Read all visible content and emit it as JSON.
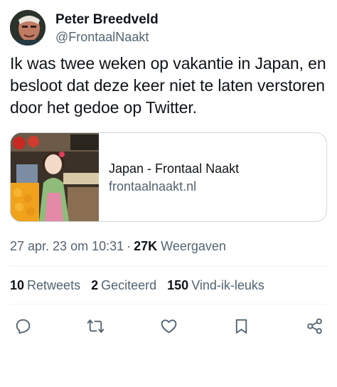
{
  "author": {
    "display_name": "Peter Breedveld",
    "handle": "@FrontaalNaakt"
  },
  "tweet": {
    "text": "Ik was twee weken op vakantie in Japan, en besloot dat deze keer niet te laten verstoren door het gedoe op Twitter."
  },
  "link_card": {
    "title": "Japan - Frontaal Naakt",
    "domain": "frontaalnaakt.nl"
  },
  "meta": {
    "timestamp": "27 apr. 23 om 10:31",
    "separator": "·",
    "views_count": "27K",
    "views_label": "Weergaven"
  },
  "stats": {
    "retweets": {
      "count": "10",
      "label": "Retweets"
    },
    "quotes": {
      "count": "2",
      "label": "Geciteerd"
    },
    "likes": {
      "count": "150",
      "label": "Vind-ik-leuks"
    }
  },
  "actions": [
    "reply-icon",
    "retweet-icon",
    "like-icon",
    "bookmark-icon",
    "share-icon"
  ],
  "colors": {
    "text": "#0f1419",
    "secondary": "#536471",
    "border": "#cfd9de",
    "divider": "#eff3f4"
  }
}
